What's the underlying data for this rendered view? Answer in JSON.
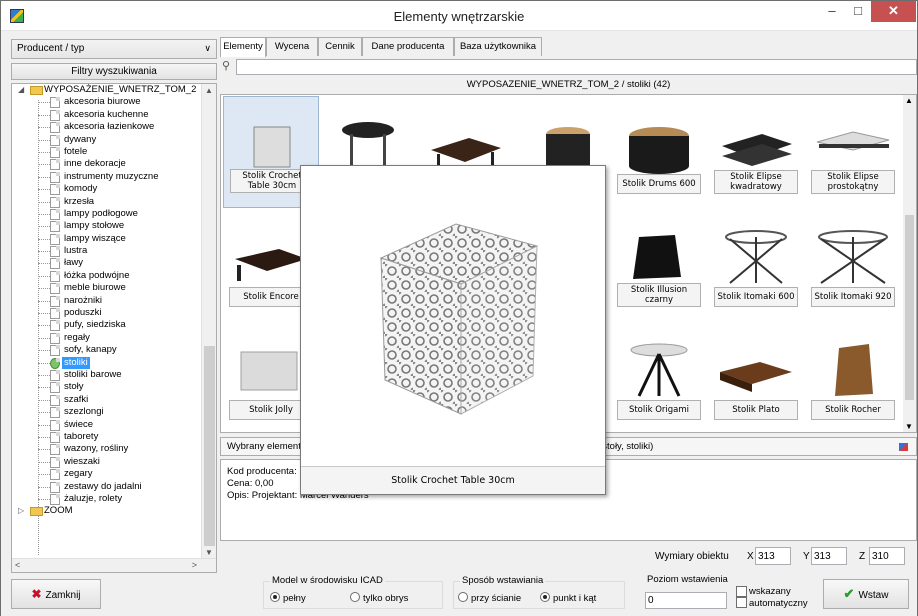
{
  "window": {
    "title": "Elementy wnętrzarskie",
    "min": "–",
    "max": "□",
    "close": "✕"
  },
  "left": {
    "combo_value": "Producent / typ",
    "filter_button": "Filtry wyszukiwania",
    "tree_root": "WYPOSAŻENIE_WNETRZ_TOM_2",
    "tree_items": [
      "akcesoria biurowe",
      "akcesoria kuchenne",
      "akcesoria łazienkowe",
      "dywany",
      "fotele",
      "inne dekoracje",
      "instrumenty muzyczne",
      "komody",
      "krzesła",
      "lampy podłogowe",
      "lampy stołowe",
      "lampy wiszące",
      "lustra",
      "ławy",
      "łóżka podwójne",
      "meble biurowe",
      "narożniki",
      "poduszki",
      "pufy, siedziska",
      "regały",
      "sofy, kanapy",
      "stoliki",
      "stoliki barowe",
      "stoły",
      "szafki",
      "szezlongi",
      "świece",
      "taborety",
      "wazony, rośliny",
      "wieszaki",
      "zegary",
      "zestawy do jadalni",
      "żaluzje, rolety"
    ],
    "selected_item": "stoliki",
    "tree_root2": "ZOOM"
  },
  "tabs": [
    "Elementy",
    "Wycena",
    "Cennik",
    "Dane producenta",
    "Baza użytkownika"
  ],
  "search": {
    "value": "",
    "placeholder": ""
  },
  "path": "WYPOSAZENIE_WNETRZ_TOM_2 / stoliki (42)",
  "grid": [
    {
      "label": "Stolik Crochet Table 30cm"
    },
    {
      "label": ""
    },
    {
      "label": ""
    },
    {
      "label": ""
    },
    {
      "label": "Stolik Drums 600"
    },
    {
      "label": "Stolik Elipse kwadratowy"
    },
    {
      "label": "Stolik Elipse prostokątny"
    },
    {
      "label": "Stolik Encore"
    },
    {
      "label": ""
    },
    {
      "label": ""
    },
    {
      "label": ""
    },
    {
      "label": "Stolik Illusion czarny"
    },
    {
      "label": "Stolik Itomaki 600"
    },
    {
      "label": "Stolik Itomaki 920"
    },
    {
      "label": "Stolik Jolly"
    },
    {
      "label": ""
    },
    {
      "label": ""
    },
    {
      "label": ""
    },
    {
      "label": "Stolik Origami"
    },
    {
      "label": "Stolik Plato"
    },
    {
      "label": "Stolik Rocher"
    }
  ],
  "selected": {
    "prefix": "Wybrany element:",
    "suffix": "/ stoły, stoliki)"
  },
  "details": {
    "code": "Kod producenta: M",
    "price": "Cena: 0,00",
    "desc": "Opis: Projektant: Marcel Wanders"
  },
  "preview": {
    "caption": "Stolik Crochet Table 30cm"
  },
  "dims": {
    "label": "Wymiary obiektu",
    "x_label": "X",
    "x": "313",
    "y_label": "Y",
    "y": "313",
    "z_label": "Z",
    "z": "310"
  },
  "bottom": {
    "close_label": "Zamknij",
    "model_group": "Model w środowisku ICAD",
    "model_opt1": "pełny",
    "model_opt2": "tylko obrys",
    "insert_group": "Sposób wstawiania",
    "insert_opt1": "przy ścianie",
    "insert_opt2": "punkt i kąt",
    "level_group": "Poziom wstawienia",
    "level_value": "0",
    "chk1": "wskazany",
    "chk2": "automatyczny",
    "insert_button": "Wstaw"
  }
}
